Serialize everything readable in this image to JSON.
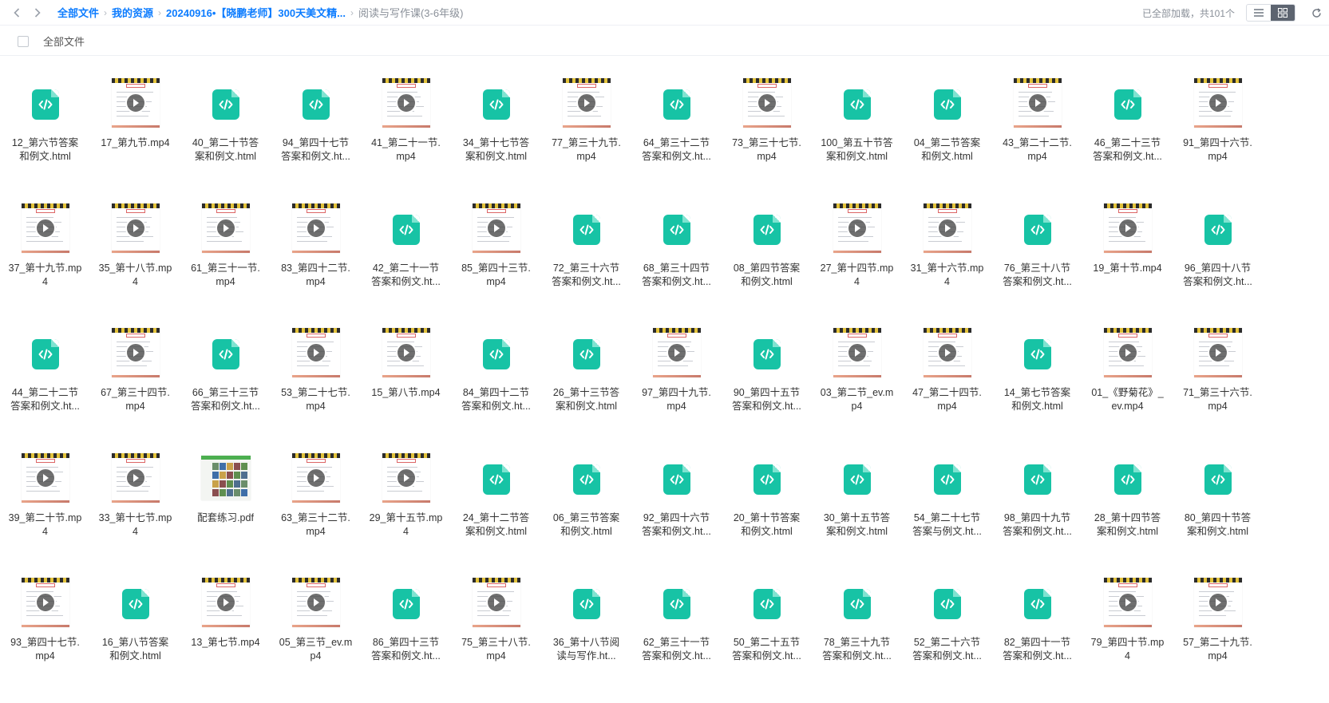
{
  "topbar": {
    "back_icon": "chevron-left-icon",
    "forward_icon": "chevron-right-icon",
    "breadcrumb": [
      "全部文件",
      "我的资源",
      "20240916•【晓鹏老师】300天美文精..."
    ],
    "current": "阅读与写作课(3-6年级)",
    "loaded_text": "已全部加载，共101个",
    "list_view_icon": "list-view-icon",
    "grid_view_icon": "grid-view-icon",
    "refresh_icon": "refresh-icon"
  },
  "subbar": {
    "label": "全部文件"
  },
  "colors": {
    "link": "#0c7cff",
    "html_icon": "#17c3a5"
  },
  "files": [
    {
      "name": "12_第六节答案和例文.html",
      "type": "html"
    },
    {
      "name": "17_第九节.mp4",
      "type": "video"
    },
    {
      "name": "40_第二十节答案和例文.html",
      "type": "html"
    },
    {
      "name": "94_第四十七节答案和例文.ht...",
      "type": "html"
    },
    {
      "name": "41_第二十一节.mp4",
      "type": "video"
    },
    {
      "name": "34_第十七节答案和例文.html",
      "type": "html"
    },
    {
      "name": "77_第三十九节.mp4",
      "type": "video"
    },
    {
      "name": "64_第三十二节答案和例文.ht...",
      "type": "html"
    },
    {
      "name": "73_第三十七节.mp4",
      "type": "video"
    },
    {
      "name": "100_第五十节答案和例文.html",
      "type": "html"
    },
    {
      "name": "04_第二节答案和例文.html",
      "type": "html"
    },
    {
      "name": "43_第二十二节.mp4",
      "type": "video"
    },
    {
      "name": "46_第二十三节答案和例文.ht...",
      "type": "html"
    },
    {
      "name": "91_第四十六节.mp4",
      "type": "video"
    },
    {
      "name": "37_第十九节.mp4",
      "type": "video"
    },
    {
      "name": "35_第十八节.mp4",
      "type": "video"
    },
    {
      "name": "61_第三十一节.mp4",
      "type": "video"
    },
    {
      "name": "83_第四十二节.mp4",
      "type": "video"
    },
    {
      "name": "42_第二十一节答案和例文.ht...",
      "type": "html"
    },
    {
      "name": "85_第四十三节.mp4",
      "type": "video"
    },
    {
      "name": "72_第三十六节答案和例文.ht...",
      "type": "html"
    },
    {
      "name": "68_第三十四节答案和例文.ht...",
      "type": "html"
    },
    {
      "name": "08_第四节答案和例文.html",
      "type": "html"
    },
    {
      "name": "27_第十四节.mp4",
      "type": "video"
    },
    {
      "name": "31_第十六节.mp4",
      "type": "video"
    },
    {
      "name": "76_第三十八节答案和例文.ht...",
      "type": "html"
    },
    {
      "name": "19_第十节.mp4",
      "type": "video"
    },
    {
      "name": "96_第四十八节答案和例文.ht...",
      "type": "html"
    },
    {
      "name": "44_第二十二节答案和例文.ht...",
      "type": "html"
    },
    {
      "name": "67_第三十四节.mp4",
      "type": "video"
    },
    {
      "name": "66_第三十三节答案和例文.ht...",
      "type": "html"
    },
    {
      "name": "53_第二十七节.mp4",
      "type": "video"
    },
    {
      "name": "15_第八节.mp4",
      "type": "video"
    },
    {
      "name": "84_第四十二节答案和例文.ht...",
      "type": "html"
    },
    {
      "name": "26_第十三节答案和例文.html",
      "type": "html"
    },
    {
      "name": "97_第四十九节.mp4",
      "type": "video"
    },
    {
      "name": "90_第四十五节答案和例文.ht...",
      "type": "html"
    },
    {
      "name": "03_第二节_ev.mp4",
      "type": "video"
    },
    {
      "name": "47_第二十四节.mp4",
      "type": "video"
    },
    {
      "name": "14_第七节答案和例文.html",
      "type": "html"
    },
    {
      "name": "01_《野菊花》_ev.mp4",
      "type": "video"
    },
    {
      "name": "71_第三十六节.mp4",
      "type": "video"
    },
    {
      "name": "39_第二十节.mp4",
      "type": "video"
    },
    {
      "name": "33_第十七节.mp4",
      "type": "video"
    },
    {
      "name": "配套练习.pdf",
      "type": "pdf"
    },
    {
      "name": "63_第三十二节.mp4",
      "type": "video"
    },
    {
      "name": "29_第十五节.mp4",
      "type": "video"
    },
    {
      "name": "24_第十二节答案和例文.html",
      "type": "html"
    },
    {
      "name": "06_第三节答案和例文.html",
      "type": "html"
    },
    {
      "name": "92_第四十六节答案和例文.ht...",
      "type": "html"
    },
    {
      "name": "20_第十节答案和例文.html",
      "type": "html"
    },
    {
      "name": "30_第十五节答案和例文.html",
      "type": "html"
    },
    {
      "name": "54_第二十七节答案与例文.ht...",
      "type": "html"
    },
    {
      "name": "98_第四十九节答案和例文.ht...",
      "type": "html"
    },
    {
      "name": "28_第十四节答案和例文.html",
      "type": "html"
    },
    {
      "name": "80_第四十节答案和例文.html",
      "type": "html"
    },
    {
      "name": "93_第四十七节.mp4",
      "type": "video"
    },
    {
      "name": "16_第八节答案和例文.html",
      "type": "html"
    },
    {
      "name": "13_第七节.mp4",
      "type": "video"
    },
    {
      "name": "05_第三节_ev.mp4",
      "type": "video"
    },
    {
      "name": "86_第四十三节答案和例文.ht...",
      "type": "html"
    },
    {
      "name": "75_第三十八节.mp4",
      "type": "video"
    },
    {
      "name": "36_第十八节阅读与写作.ht...",
      "type": "html"
    },
    {
      "name": "62_第三十一节答案和例文.ht...",
      "type": "html"
    },
    {
      "name": "50_第二十五节答案和例文.ht...",
      "type": "html"
    },
    {
      "name": "78_第三十九节答案和例文.ht...",
      "type": "html"
    },
    {
      "name": "52_第二十六节答案和例文.ht...",
      "type": "html"
    },
    {
      "name": "82_第四十一节答案和例文.ht...",
      "type": "html"
    },
    {
      "name": "79_第四十节.mp4",
      "type": "video"
    },
    {
      "name": "57_第二十九节.mp4",
      "type": "video"
    }
  ]
}
